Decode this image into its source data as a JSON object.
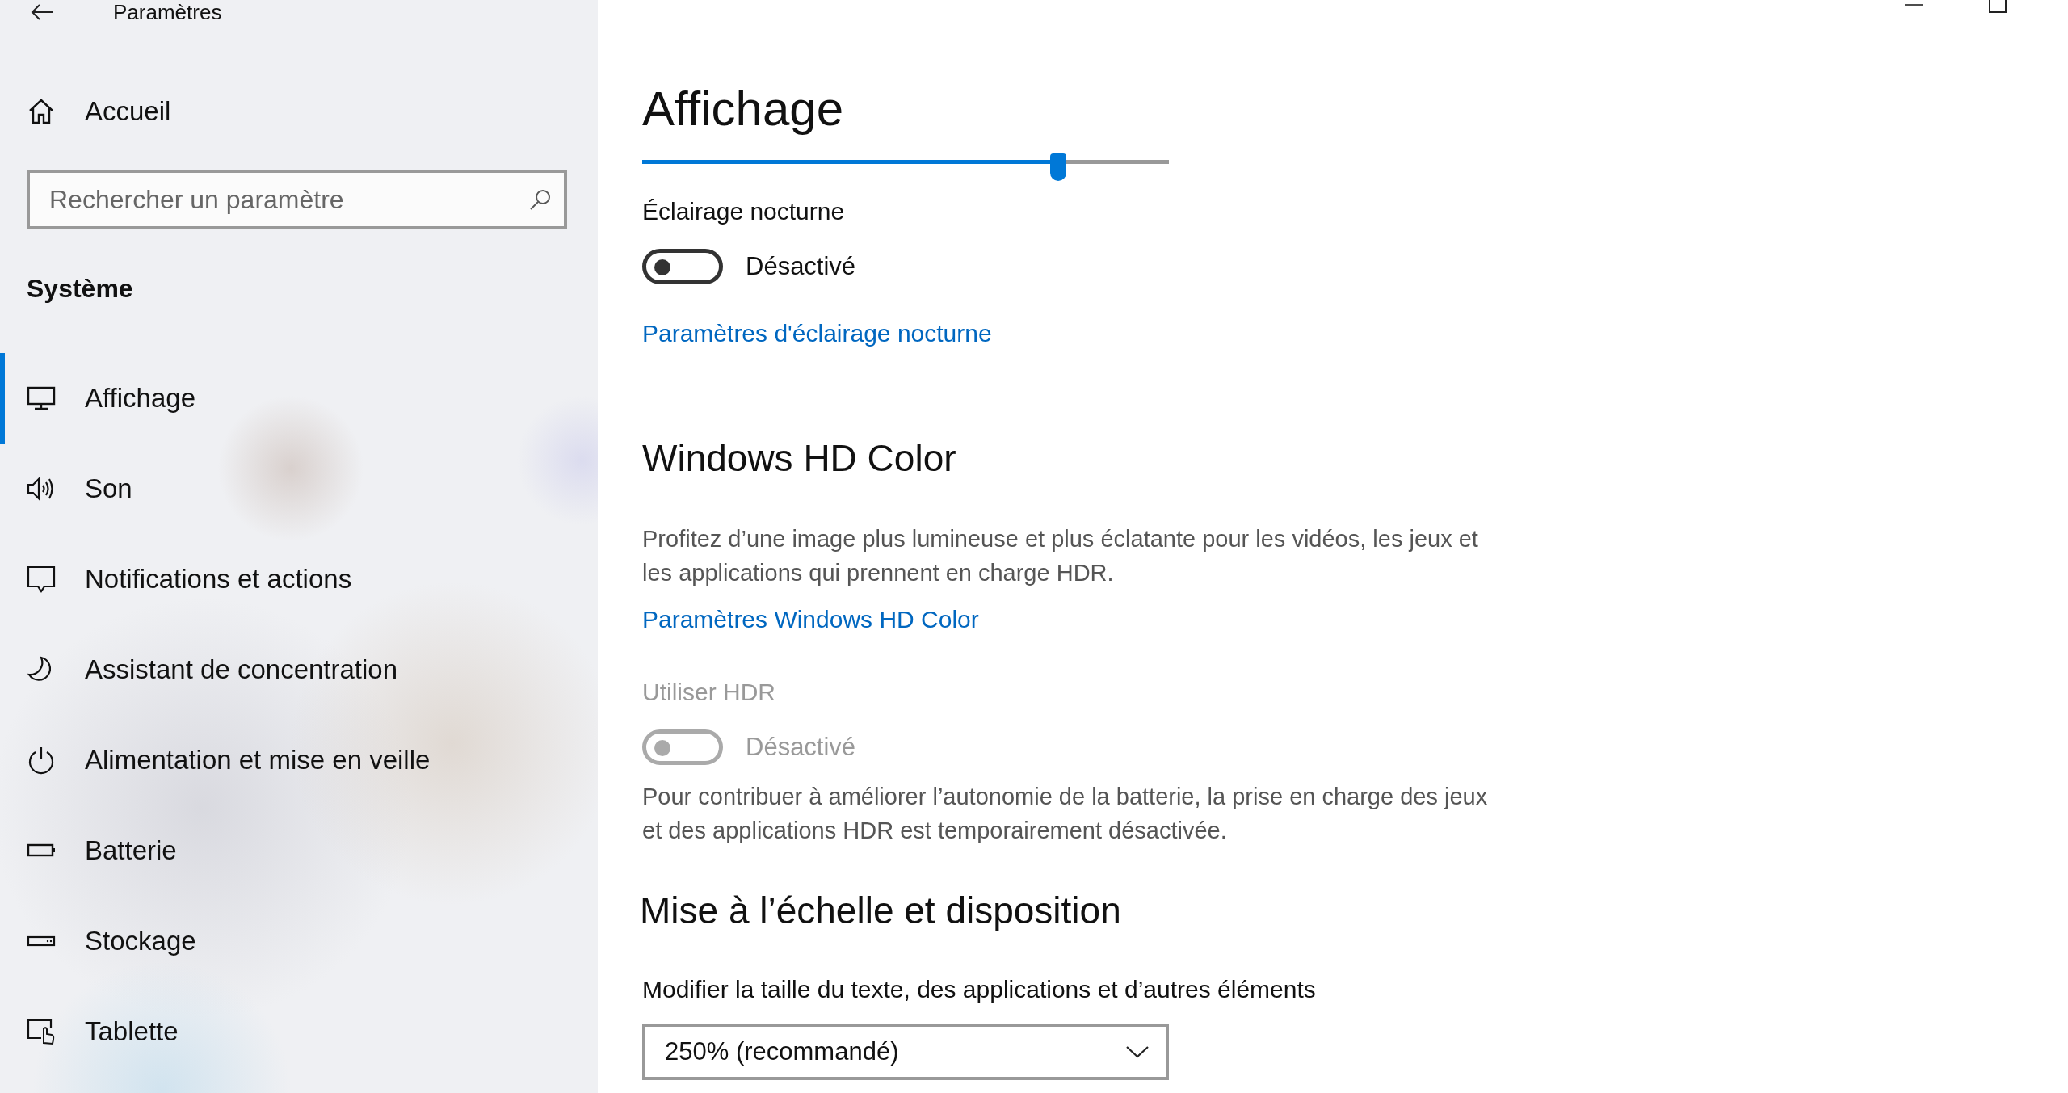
{
  "window": {
    "title": "Paramètres"
  },
  "sidebar": {
    "home": {
      "label": "Accueil"
    },
    "search": {
      "placeholder": "Rechercher un paramètre"
    },
    "section": "Système",
    "items": [
      {
        "label": "Affichage",
        "kind": "display",
        "selected": true
      },
      {
        "label": "Son",
        "kind": "sound",
        "selected": false
      },
      {
        "label": "Notifications et actions",
        "kind": "message",
        "selected": false
      },
      {
        "label": "Assistant de concentration",
        "kind": "moon",
        "selected": false
      },
      {
        "label": "Alimentation et mise en veille",
        "kind": "power",
        "selected": false
      },
      {
        "label": "Batterie",
        "kind": "battery",
        "selected": false
      },
      {
        "label": "Stockage",
        "kind": "drive",
        "selected": false
      },
      {
        "label": "Tablette",
        "kind": "tablet",
        "selected": false
      }
    ]
  },
  "main": {
    "title": "Affichage",
    "brightness": {
      "level": 0.79
    },
    "night_light": {
      "label": "Éclairage nocturne",
      "on": false,
      "disabled": false,
      "state": "Désactivé"
    },
    "night_link": "Paramètres d'éclairage nocturne",
    "hd_heading": "Windows HD Color",
    "hd_description": "Profitez d’une image plus lumineuse et plus éclatante pour les vidéos, les jeux et les applications qui prennent en charge HDR.",
    "hd_link": "Paramètres Windows HD Color",
    "hdr": {
      "label": "Utiliser HDR",
      "on": false,
      "disabled": true,
      "state": "Désactivé"
    },
    "hdr_note": "Pour contribuer à améliorer l’autonomie de la batterie, la prise en charge des jeux et des applications HDR est temporairement désactivée.",
    "scale_heading": "Mise à l’échelle et disposition",
    "scale_label": "Modifier la taille du texte, des applications et d’autres éléments",
    "scale_value": "250% (recommandé)"
  }
}
